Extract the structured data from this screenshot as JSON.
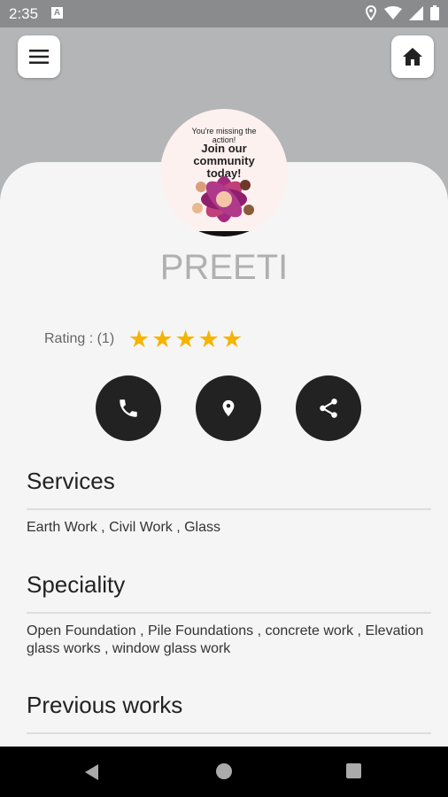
{
  "status_bar": {
    "time": "2:35",
    "app_icon": "A"
  },
  "header": {
    "menu_icon": "menu-icon",
    "home_icon": "home-icon"
  },
  "avatar": {
    "line1": "You're missing the",
    "line2": "action!",
    "headline1": "Join our",
    "headline2": "community",
    "headline3": "today!"
  },
  "profile": {
    "name": "PREETI",
    "rating_label": "Rating : (1)",
    "rating_stars": 5
  },
  "actions": [
    "phone-icon",
    "location-icon",
    "share-icon"
  ],
  "sections": {
    "services": {
      "title": "Services",
      "text": "Earth Work , Civil Work , Glass"
    },
    "speciality": {
      "title": "Speciality",
      "text": "Open Foundation , Pile Foundations , concrete work , Elevation glass works , window glass work"
    },
    "previous_works": {
      "title": "Previous works"
    }
  },
  "colors": {
    "star": "#f5b400",
    "action_button": "#222222",
    "sheet": "#f5f5f5",
    "background": "#b4b5b7"
  }
}
